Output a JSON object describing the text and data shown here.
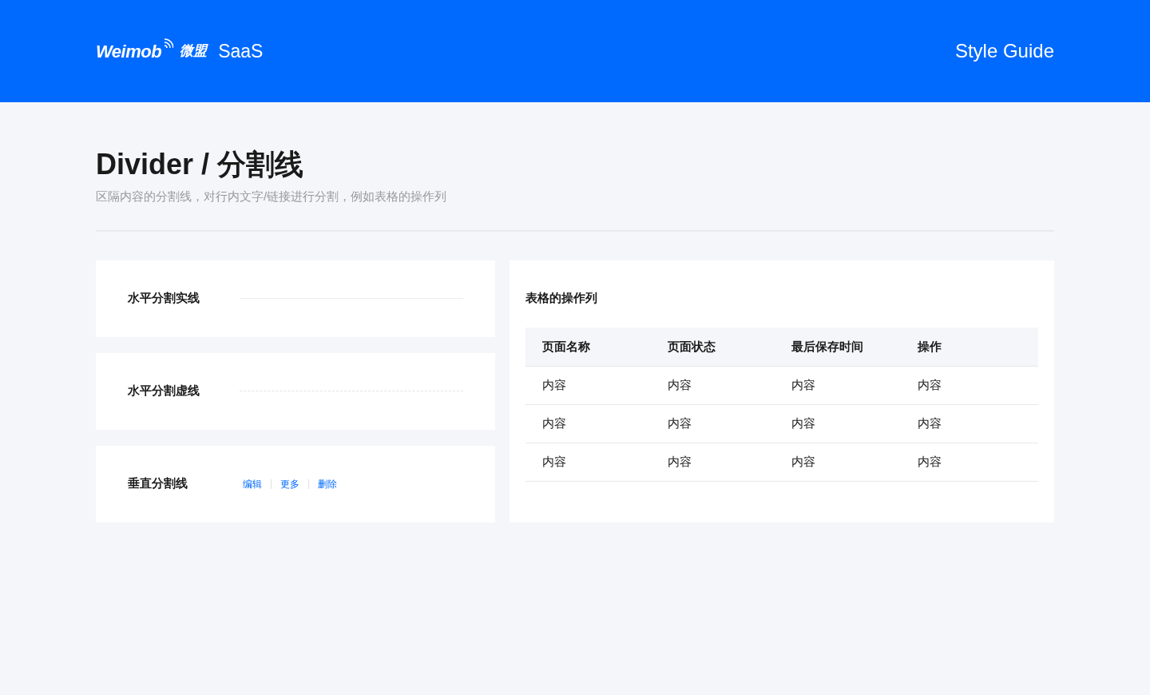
{
  "header": {
    "logo_text": "Weimob",
    "logo_cn": "微盟",
    "product": "SaaS",
    "right_title": "Style Guide"
  },
  "page": {
    "title": "Divider / 分割线",
    "subtitle": "区隔内容的分割线，对行内文字/链接进行分割，例如表格的操作列"
  },
  "examples": [
    {
      "kind": "solid",
      "label": "水平分割实线"
    },
    {
      "kind": "dashed",
      "label": "水平分割虚线"
    },
    {
      "kind": "vertical",
      "label": "垂直分割线",
      "links": [
        "编辑",
        "更多",
        "删除"
      ]
    }
  ],
  "table_card": {
    "title": "表格的操作列",
    "columns": [
      "页面名称",
      "页面状态",
      "最后保存时间",
      "操作"
    ],
    "rows": [
      [
        "内容",
        "内容",
        "内容",
        "内容"
      ],
      [
        "内容",
        "内容",
        "内容",
        "内容"
      ],
      [
        "内容",
        "内容",
        "内容",
        "内容"
      ]
    ]
  }
}
